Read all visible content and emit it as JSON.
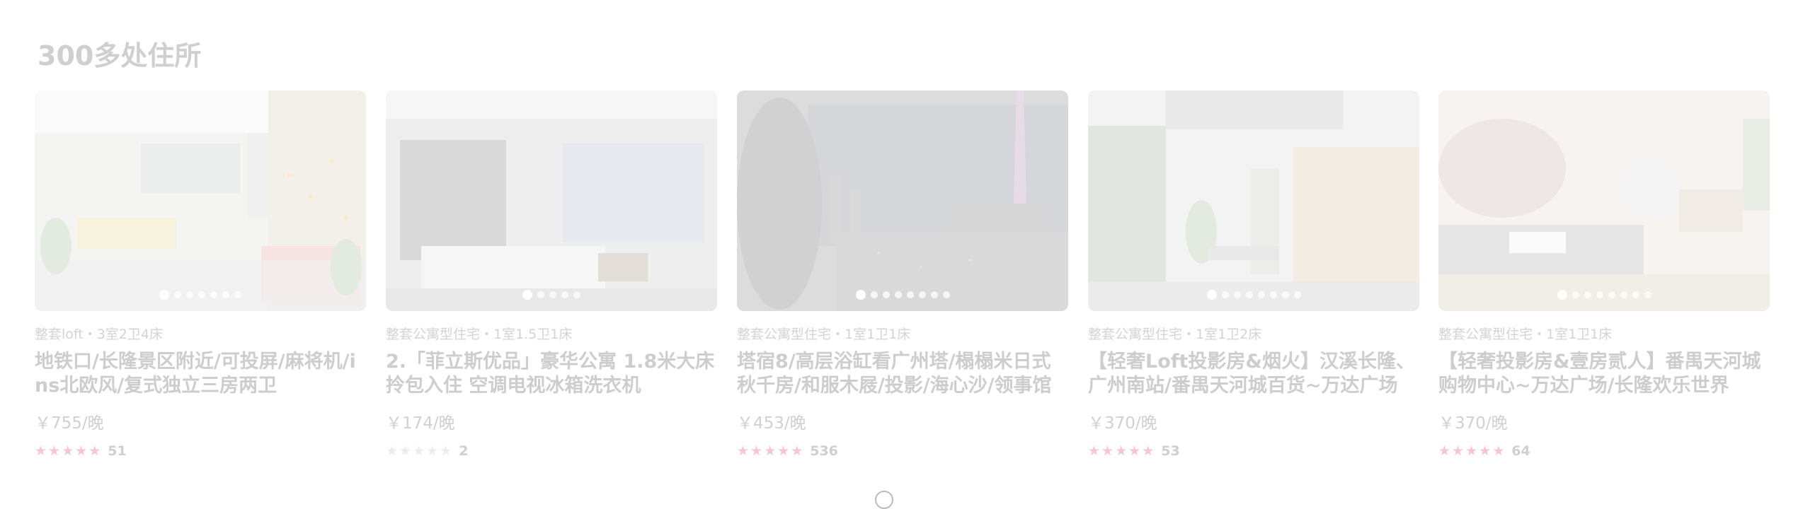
{
  "section": {
    "title": "300多处住所"
  },
  "colors": {
    "star_on": "#f7c6cd",
    "star_off": "#ececec",
    "text_muted": "#cdcdcd"
  },
  "listings": [
    {
      "meta": "整套loft・3室2卫4床",
      "name": "地铁口/长隆景区附近/可投屏/麻将机/ins北欧风/复式独立三房两卫",
      "price": "￥755/晚",
      "stars": 5,
      "reviews": "51",
      "photo_count": 7,
      "active_photo": 0
    },
    {
      "meta": "整套公寓型住宅・1室1.5卫1床",
      "name": "2.「菲立斯优品」豪华公寓 1.8米大床 拎包入住 空调电视冰箱洗衣机",
      "price": "￥174/晚",
      "stars": 0,
      "reviews": "2",
      "photo_count": 5,
      "active_photo": 0
    },
    {
      "meta": "整套公寓型住宅・1室1卫1床",
      "name": "塔宿8/高层浴缸看广州塔/榻榻米日式秋千房/和服木屐/投影/海心沙/领事馆",
      "price": "￥453/晚",
      "stars": 5,
      "reviews": "536",
      "photo_count": 8,
      "active_photo": 0
    },
    {
      "meta": "整套公寓型住宅・1室1卫2床",
      "name": "【轻奢Loft投影房&烟火】汉溪长隆、广州南站/番禺天河城百货~万达广场",
      "price": "￥370/晚",
      "stars": 5,
      "reviews": "53",
      "photo_count": 8,
      "active_photo": 0
    },
    {
      "meta": "整套公寓型住宅・1室1卫1床",
      "name": "【轻奢投影房&壹房贰人】番禺天河城购物中心~万达广场/长隆欢乐世界",
      "price": "￥370/晚",
      "stars": 5,
      "reviews": "64",
      "photo_count": 8,
      "active_photo": 0
    }
  ]
}
